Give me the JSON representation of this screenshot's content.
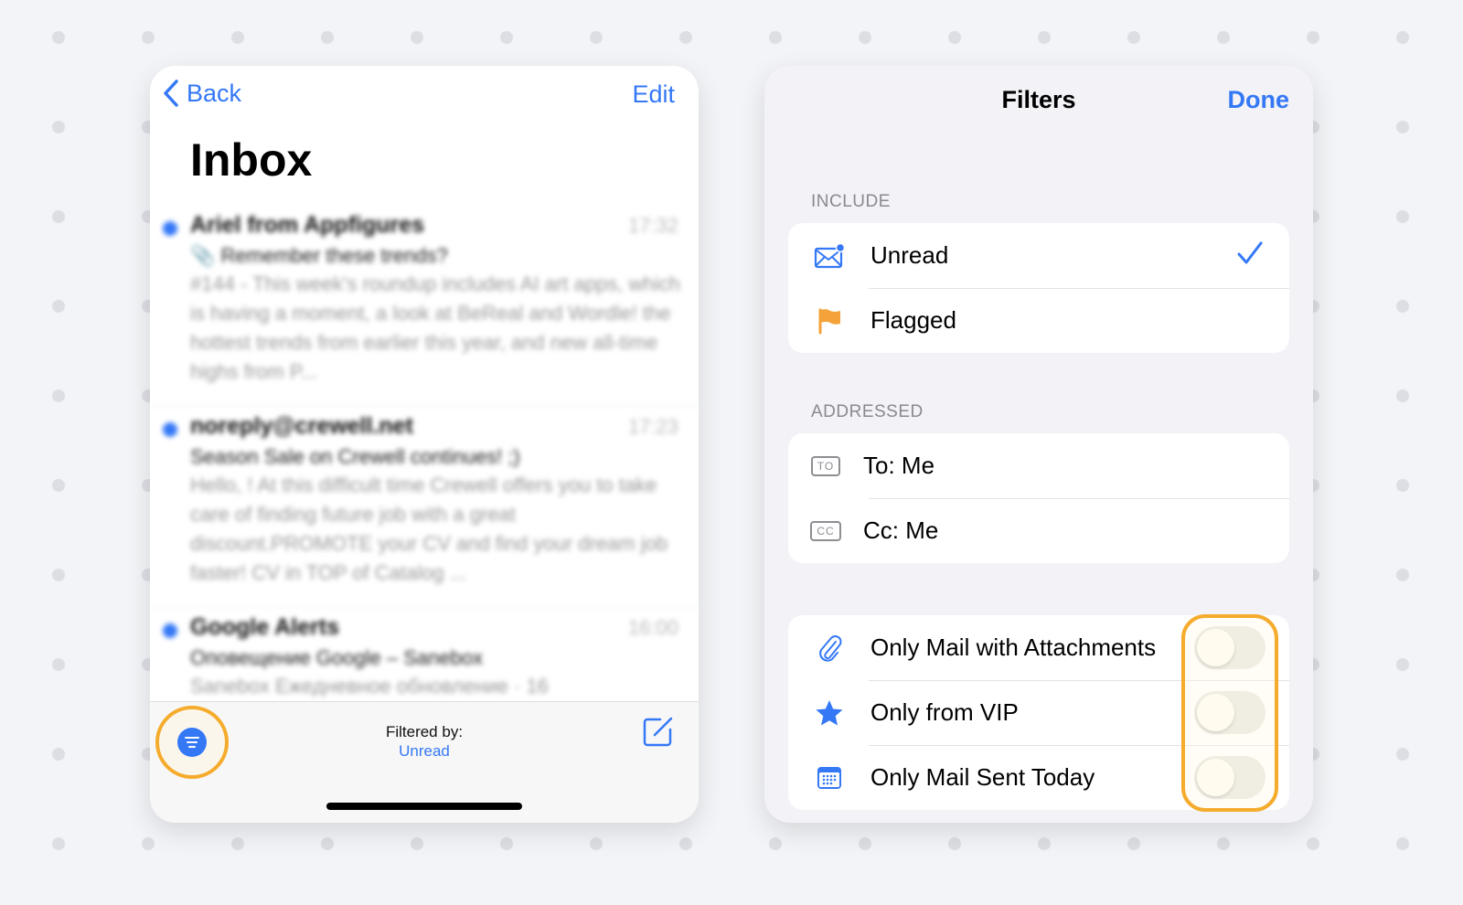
{
  "inbox": {
    "back_label": "Back",
    "edit_label": "Edit",
    "title": "Inbox",
    "emails": [
      {
        "from": "Ariel from Appfigures",
        "time": "17:32",
        "subject": "📎 Remember these trends?",
        "preview": "#144 - This week's roundup includes AI art apps, which is having a moment, a look at BeReal and Wordle! the hottest trends from earlier this year, and new all-time highs from P..."
      },
      {
        "from": "noreply@crewell.net",
        "time": "17:23",
        "subject": "Season Sale on Crewell continues! ;)",
        "preview": "Hello, ! At this difficult time Crewell offers you to take care of finding future job with a great discount.PROMOTE your CV and find your dream job faster! CV in TOP of Catalog ..."
      },
      {
        "from": "Google Alerts",
        "time": "16:00",
        "subject": "Оповещение Google – Sanebox",
        "preview": "Sanebox Ежедневное обновление · 16"
      }
    ],
    "bottom": {
      "filtered_by_label": "Filtered by:",
      "filter_value": "Unread"
    }
  },
  "filters": {
    "title": "Filters",
    "done_label": "Done",
    "include": {
      "header": "INCLUDE",
      "items": [
        {
          "label": "Unread",
          "icon": "envelope-unread-icon",
          "checked": true
        },
        {
          "label": "Flagged",
          "icon": "flag-icon",
          "checked": false
        }
      ]
    },
    "addressed": {
      "header": "ADDRESSED",
      "items": [
        {
          "label": "To: Me",
          "icon": "to-badge-icon",
          "badge": "TO"
        },
        {
          "label": "Cc: Me",
          "icon": "cc-badge-icon",
          "badge": "CC"
        }
      ]
    },
    "toggles": [
      {
        "label": "Only Mail with Attachments",
        "icon": "paperclip-icon",
        "on": false
      },
      {
        "label": "Only from VIP",
        "icon": "star-icon",
        "on": false
      },
      {
        "label": "Only Mail Sent Today",
        "icon": "calendar-icon",
        "on": false
      }
    ]
  },
  "colors": {
    "accent": "#3478f6",
    "highlight": "#f5ab2c",
    "flag": "#f4a23a"
  }
}
